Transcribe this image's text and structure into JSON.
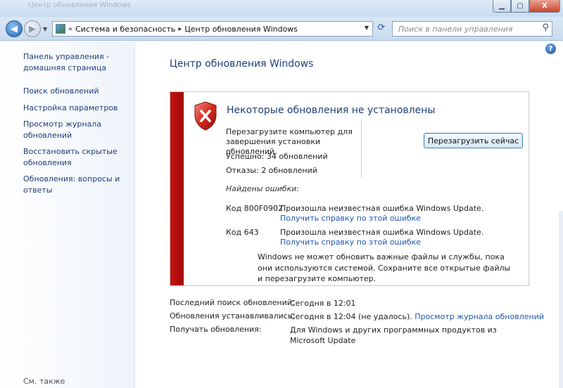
{
  "window": {
    "title_blurred": "Центр обновления Windows",
    "min_label": "▁",
    "max_label": "▢",
    "close_label": "X"
  },
  "navbar": {
    "breadcrumb_sep": "«",
    "crumbs": [
      "Система и безопасность",
      "Центр обновления Windows"
    ],
    "crumb_arrow": "▸",
    "search_placeholder": "Поиск в панели управления"
  },
  "sidebar": {
    "items": [
      {
        "label": "Панель управления - домашняя страница"
      },
      {
        "label": "Поиск обновлений"
      },
      {
        "label": "Настройка параметров"
      },
      {
        "label": "Просмотр журнала обновлений"
      },
      {
        "label": "Восстановить скрытые обновления"
      },
      {
        "label": "Обновления: вопросы и ответы"
      }
    ],
    "see_also": "См. также"
  },
  "main": {
    "title": "Центр обновления Windows",
    "help_label": "?",
    "alert": {
      "title": "Некоторые обновления не установлены",
      "message": "Перезагрузите компьютер для завершения установки обновлений.",
      "success": "Успешно: 34 обновлений",
      "failures": "Отказы: 2 обновлений",
      "restart_button": "Перезагрузить сейчас",
      "found_errors": "Найдены ошибки:",
      "errors": [
        {
          "code": "Код 800F0902",
          "text": "Произошла неизвестная ошибка Windows Update.",
          "help": "Получить справку по этой ошибке"
        },
        {
          "code": "Код 643",
          "text": "Произошла неизвестная ошибка Windows Update.",
          "help": "Получить справку по этой ошибке"
        }
      ],
      "note": "Windows не может обновить важные файлы и службы, пока они используются системой. Сохраните все открытые файлы и перезагрузите компьютер."
    },
    "info": {
      "last_search_label": "Последний поиск обновлений:",
      "last_search_value": "Сегодня в 12:01",
      "installed_label": "Обновления устанавливались:",
      "installed_value": "Сегодня в 12:04 (не удалось).",
      "installed_link": "Просмотр журнала обновлений",
      "receive_label": "Получать обновления:",
      "receive_value": "Для Windows и других программных продуктов из Microsoft Update"
    }
  },
  "colors": {
    "accent_link": "#1b56b3",
    "title_blue": "#1e3f7a",
    "error_red": "#c31313"
  }
}
